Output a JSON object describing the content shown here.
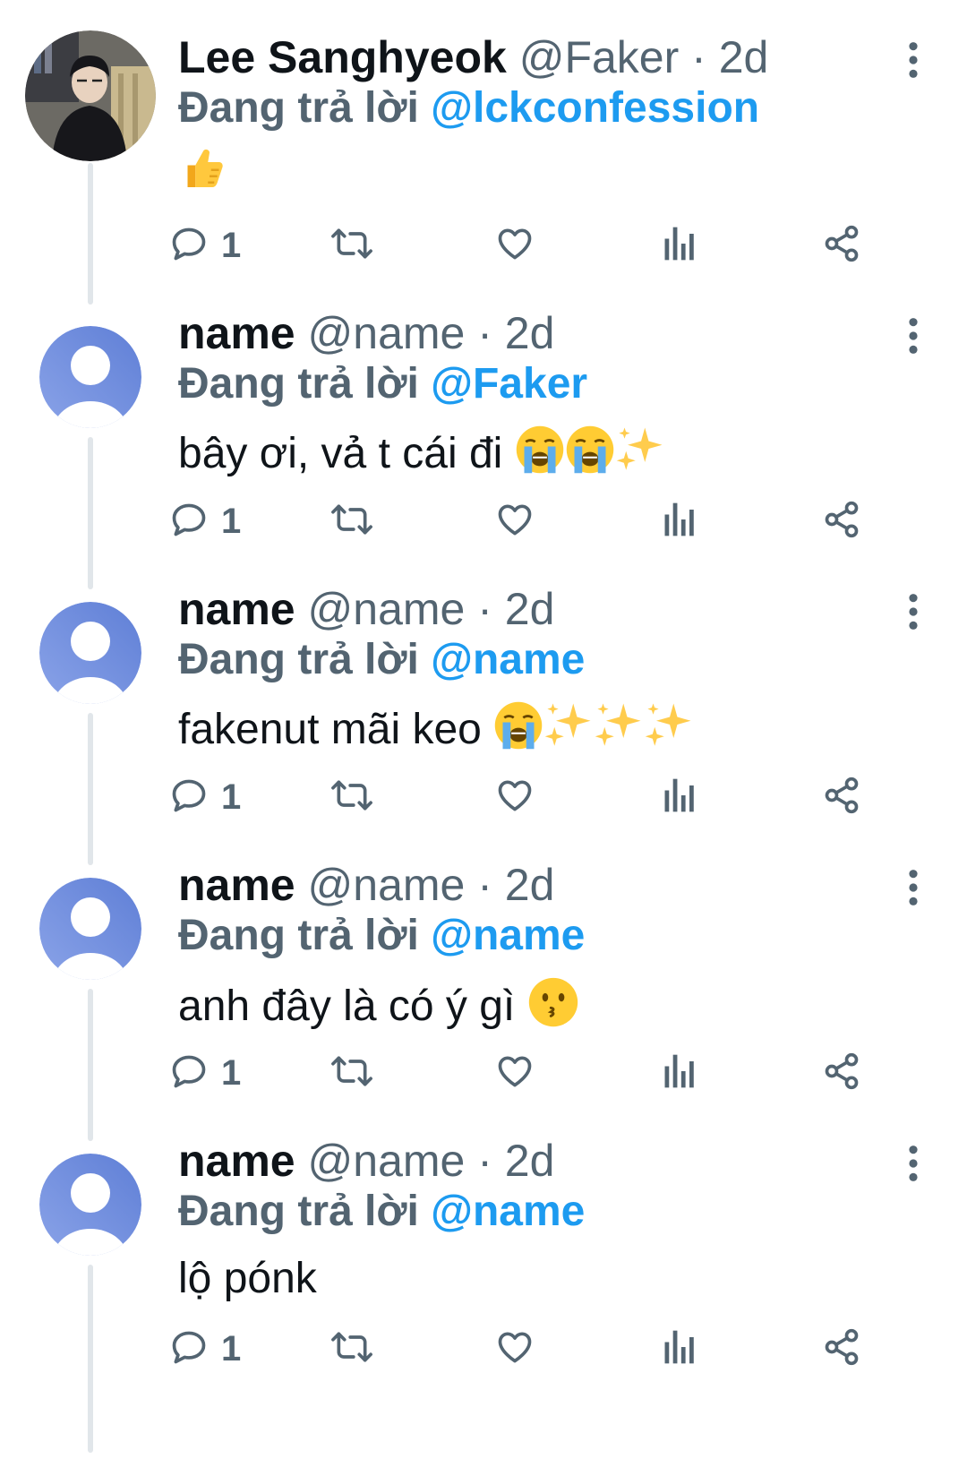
{
  "tweets": [
    {
      "name": "Lee Sanghyeok",
      "meta": "@Faker · 2d",
      "reply_prefix": "Đang trả lời",
      "reply_mention": "@lckconfession",
      "text": "",
      "emojis": [
        "thumbs-up"
      ],
      "reply_count": "1",
      "avatar": "profile-photo"
    },
    {
      "name": "name",
      "meta": "@name · 2d",
      "reply_prefix": "Đang trả lời",
      "reply_mention": "@Faker",
      "text": "bây ơi, vả t cái đi",
      "emojis": [
        "loudly-crying-face",
        "loudly-crying-face",
        "sparkles"
      ],
      "reply_count": "1",
      "avatar": "default"
    },
    {
      "name": "name",
      "meta": "@name · 2d",
      "reply_prefix": "Đang trả lời",
      "reply_mention": "@name",
      "text": "fakenut mãi keo",
      "emojis": [
        "loudly-crying-face",
        "sparkles",
        "sparkles",
        "sparkles"
      ],
      "reply_count": "1",
      "avatar": "default"
    },
    {
      "name": "name",
      "meta": "@name · 2d",
      "reply_prefix": "Đang trả lời",
      "reply_mention": "@name",
      "text": "anh đây là có ý gì",
      "emojis": [
        "kissing-face"
      ],
      "reply_count": "1",
      "avatar": "default"
    },
    {
      "name": "name",
      "meta": "@name · 2d",
      "reply_prefix": "Đang trả lời",
      "reply_mention": "@name",
      "text": "lộ pónk",
      "emojis": [],
      "reply_count": "1",
      "avatar": "default"
    }
  ],
  "icons": [
    "more-icon",
    "reply-icon",
    "retweet-icon",
    "like-icon",
    "views-icon",
    "share-icon"
  ],
  "colors": {
    "text": "#0f1419",
    "secondary": "#536471",
    "mention": "#1d9bf0",
    "thread_line": "#e1e6ea",
    "avatar_gradient_start": "#8aa3e8",
    "avatar_gradient_end": "#5f7fd6"
  }
}
